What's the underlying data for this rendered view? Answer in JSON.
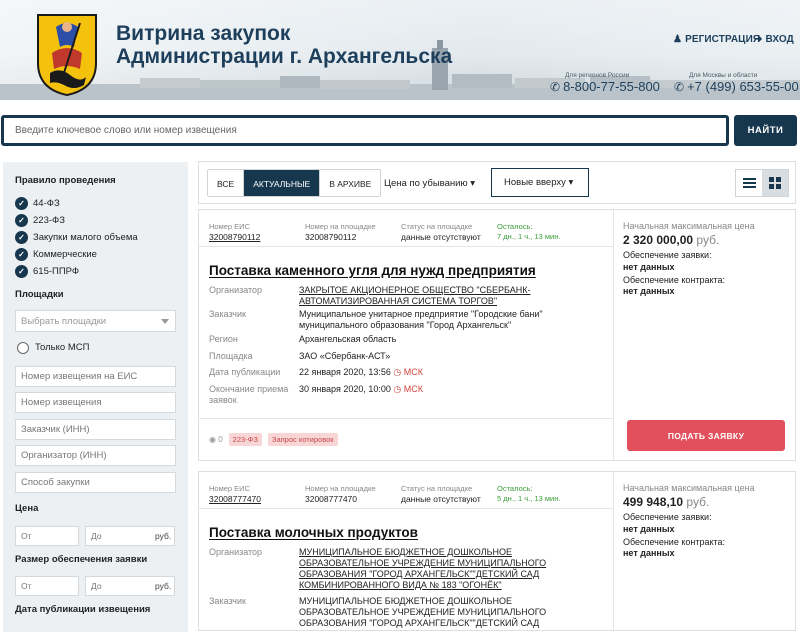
{
  "header": {
    "title_line1": "Витрина закупок",
    "title_line2": "Администрации г. Архангельска",
    "register": "РЕГИСТРАЦИЯ",
    "login": "ВХОД",
    "phone_regions_caption": "Для регионов России",
    "phone_regions": "8-800-77-55-800",
    "phone_moscow_caption": "Для Москвы и области",
    "phone_moscow": "+7 (499) 653-55-00"
  },
  "search": {
    "placeholder": "Введите ключевое слово или номер извещения",
    "button": "НАЙТИ"
  },
  "sidebar": {
    "rules_title": "Правило проведения",
    "rules": [
      "44-ФЗ",
      "223-ФЗ",
      "Закупки малого объема",
      "Коммерческие",
      "615-ППРФ"
    ],
    "platforms_title": "Площадки",
    "platforms_placeholder": "Выбрать площадки",
    "smp_only": "Только МСП",
    "eis_number_placeholder": "Номер извещения на ЕИС",
    "notice_number_placeholder": "Номер извещения",
    "customer_placeholder": "Заказчик (ИНН)",
    "organizer_placeholder": "Организатор (ИНН)",
    "method_placeholder": "Способ закупки",
    "price_title": "Цена",
    "from": "От",
    "to": "До",
    "rub": "руб.",
    "security_title": "Размер обеспечения заявки",
    "pubdate_title": "Дата публикации извещения"
  },
  "toolbar": {
    "tabs": [
      "ВСЕ",
      "АКТУАЛЬНЫЕ",
      "В АРХИВЕ"
    ],
    "active_tab": "АКТУАЛЬНЫЕ",
    "sort_price": "Цена по убыванию ▾",
    "sort_new": "Новые вверху ▾"
  },
  "labels": {
    "eis_number": "Номер ЕИС",
    "platform_number": "Номер на площадке",
    "platform_status": "Статус на площадке",
    "remaining": "Осталось:",
    "organizer": "Организатор",
    "customer": "Заказчик",
    "region": "Регион",
    "platform": "Площадка",
    "pub_date": "Дата публикации",
    "end_date": "Окончание приема заявок",
    "nmc": "Начальная максимальная цена",
    "bid_security": "Обеспечение заявки:",
    "contract_security": "Обеспечение контракта:",
    "apply": "ПОДАТЬ ЗАЯВКУ",
    "msk": "МСК",
    "currency": "руб."
  },
  "cards": [
    {
      "eis_number": "32008790112",
      "platform_number": "32008790112",
      "status": "данные отсутствуют",
      "remaining": "7 дн., 1 ч., 13 мин.",
      "title": "Поставка каменного угля для нужд предприятия",
      "organizer": "ЗАКРЫТОЕ АКЦИОНЕРНОЕ ОБЩЕСТВО \"СБЕРБАНК-АВТОМАТИЗИРОВАННАЯ СИСТЕМА ТОРГОВ\"",
      "customer": "Муниципальное унитарное предприятие \"Городские бани\" муниципального образования \"Город Архангельск\"",
      "region": "Архангельская область",
      "platform": "ЗАО «Сбербанк-АСТ»",
      "pub_date": "22 января 2020, 13:56",
      "end_date": "30 января 2020, 10:00",
      "price": "2 320 000,00",
      "bid_security": "нет данных",
      "contract_security": "нет данных",
      "views": "0",
      "law_tag": "223-ФЗ",
      "type_tag": "Запрос котировок"
    },
    {
      "eis_number": "32008777470",
      "platform_number": "32008777470",
      "status": "данные отсутствуют",
      "remaining": "5 дн., 1 ч., 13 мин.",
      "title": "Поставка молочных продуктов",
      "organizer": "МУНИЦИПАЛЬНОЕ БЮДЖЕТНОЕ ДОШКОЛЬНОЕ ОБРАЗОВАТЕЛЬНОЕ УЧРЕЖДЕНИЕ МУНИЦИПАЛЬНОГО ОБРАЗОВАНИЯ \"ГОРОД АРХАНГЕЛЬСК\"\"ДЕТСКИЙ САД КОМБИНИРОВАННОГО ВИДА № 183 \"ОГОНЁК\"",
      "customer": "МУНИЦИПАЛЬНОЕ БЮДЖЕТНОЕ ДОШКОЛЬНОЕ ОБРАЗОВАТЕЛЬНОЕ УЧРЕЖДЕНИЕ МУНИЦИПАЛЬНОГО ОБРАЗОВАНИЯ \"ГОРОД АРХАНГЕЛЬСК\"\"ДЕТСКИЙ САД",
      "price": "499 948,10",
      "bid_security": "нет данных",
      "contract_security": "нет данных"
    }
  ],
  "colors": {
    "navy": "#17374f",
    "accent_red": "#e1505c",
    "green": "#3a9d3a",
    "tag_bg": "#f8d6d6"
  }
}
